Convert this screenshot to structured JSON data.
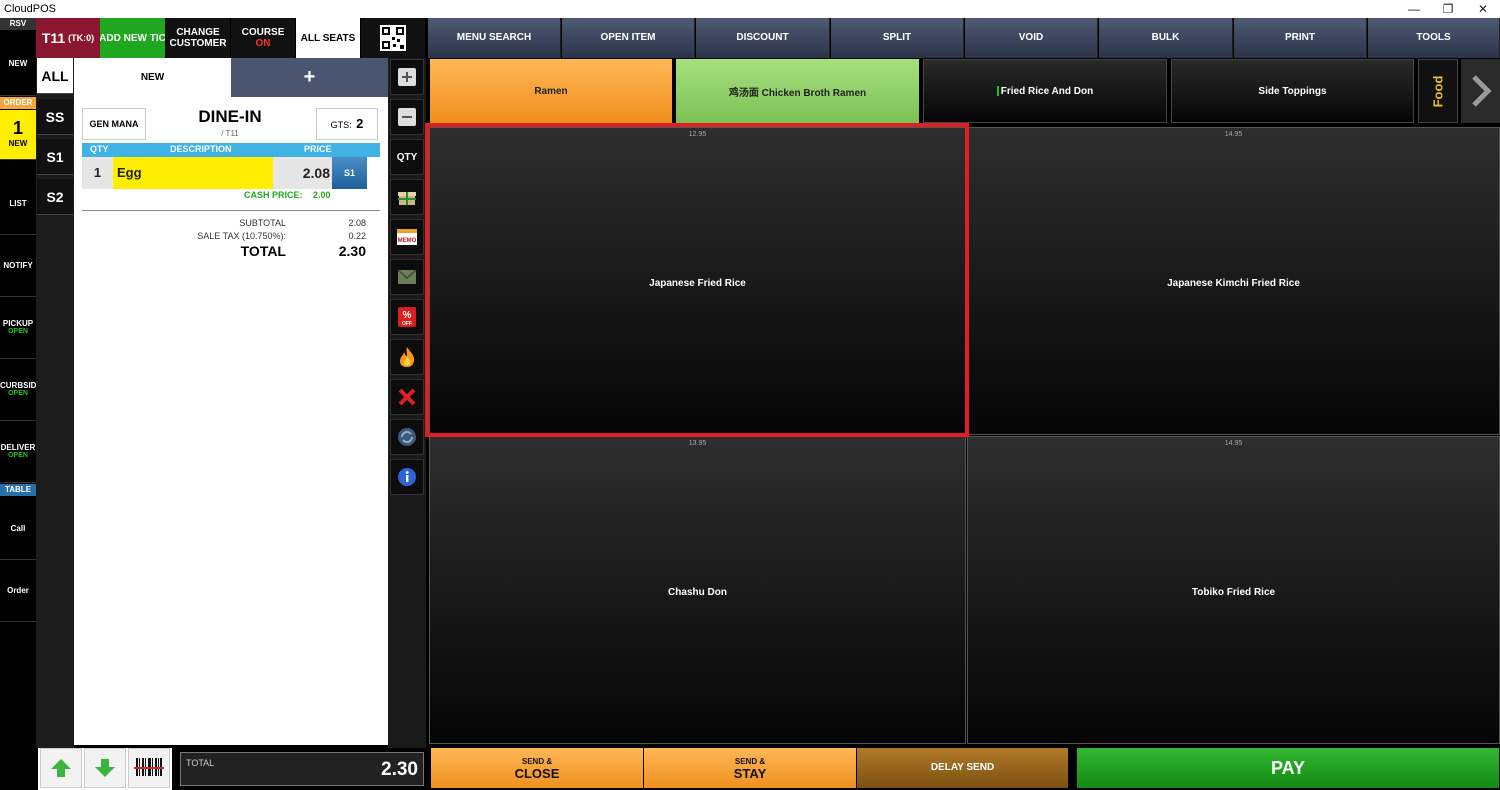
{
  "window": {
    "title": "CloudPOS",
    "minimize": "—",
    "restore": "❐",
    "close": "✕"
  },
  "leftnav": {
    "rsv": "RSV",
    "new": "NEW",
    "order_hdr": "ORDER",
    "order_count": "1",
    "order_label": "NEW",
    "list": "LIST",
    "notify": "NOTIFY",
    "pickup": "PICKUP",
    "pickup_status": "OPEN",
    "curbside": "CURBSID",
    "curbside_status": "OPEN",
    "delivery": "DELIVER",
    "delivery_status": "OPEN",
    "table_hdr": "TABLE",
    "call": "Call",
    "order": "Order"
  },
  "ticket_header": {
    "table": "T11",
    "tk": "(TK:0)",
    "add_new": "ADD NEW TIC",
    "change_customer_1": "CHANGE",
    "change_customer_2": "CUSTOMER",
    "course_1": "COURSE",
    "course_2": "ON",
    "all_seats": "ALL SEATS"
  },
  "seats": [
    "ALL",
    "SS",
    "S1",
    "S2"
  ],
  "ticket_tabs": {
    "new": "NEW",
    "plus": "+"
  },
  "ticket": {
    "server": "GEN MANA",
    "order_type": "DINE-IN",
    "table_ref": "/ T11",
    "guests_label": "GTS:",
    "guests": "2",
    "columns": [
      "QTY",
      "DESCRIPTION",
      "PRICE"
    ],
    "lines": [
      {
        "qty": "1",
        "desc": "Egg",
        "price": "2.08",
        "seat": "S1",
        "cash_label": "CASH PRICE:",
        "cash_price": "2.00"
      }
    ],
    "subtotal_label": "SUBTOTAL",
    "subtotal": "2.08",
    "tax_label": "SALE TAX (10.750%):",
    "tax": "0.22",
    "total_label": "TOTAL",
    "total": "2.30"
  },
  "tools": {
    "qty": "QTY"
  },
  "menu": [
    "MENU SEARCH",
    "OPEN ITEM",
    "DISCOUNT",
    "SPLIT",
    "VOID",
    "BULK",
    "PRINT",
    "TOOLS"
  ],
  "categories": [
    {
      "label": "Ramen",
      "bg": "#f6a43c"
    },
    {
      "label": "鸡汤面 Chicken Broth Ramen",
      "bg": "#8fd06a"
    },
    {
      "label": "Fried Rice And Don",
      "bg": "#1a1a1a"
    },
    {
      "label": "Side Toppings",
      "bg": "#1a1a1a"
    }
  ],
  "category_more": "Food",
  "items": [
    {
      "price": "12.95",
      "name": "Japanese Fried Rice"
    },
    {
      "price": "14.95",
      "name": "Japanese Kimchi Fried Rice"
    },
    {
      "price": "13.95",
      "name": "Chashu Don"
    },
    {
      "price": "14.95",
      "name": "Tobiko Fried Rice"
    }
  ],
  "bottom": {
    "total_label": "TOTAL",
    "total": "2.30",
    "send_close_1": "SEND &",
    "send_close_2": "CLOSE",
    "send_stay_1": "SEND &",
    "send_stay_2": "STAY",
    "delay_send": "DELAY SEND",
    "pay": "PAY"
  },
  "colors": {
    "highlight": "#e02020",
    "accent_green": "#1fa81f",
    "order_yellow": "#ffee00"
  }
}
